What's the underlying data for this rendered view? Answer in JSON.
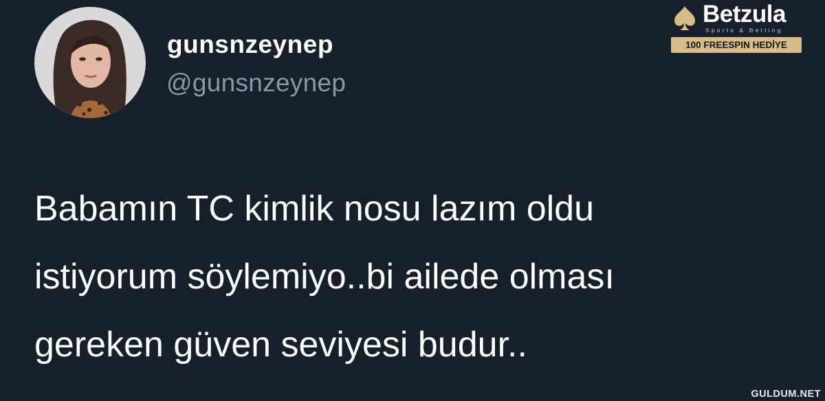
{
  "profile": {
    "display_name": "gunsnzeynep",
    "handle": "@gunsnzeynep",
    "avatar_icon": "avatar-photo"
  },
  "tweet": {
    "lines": [
      "Babamın TC kimlik nosu lazım oldu",
      "istiyorum söylemiyo..bi ailede olması",
      "gereken güven seviyesi budur.."
    ]
  },
  "ad": {
    "brand": "Betzula",
    "tagline": "Sports & Betting",
    "promo": "100 FREESPIN HEDİYE",
    "logo_icon": "spade-icon",
    "accent_color": "#d8bb86"
  },
  "watermark": "GULDUM.NET",
  "colors": {
    "background": "#15202b",
    "text": "#ffffff",
    "handle": "#8899a6"
  }
}
